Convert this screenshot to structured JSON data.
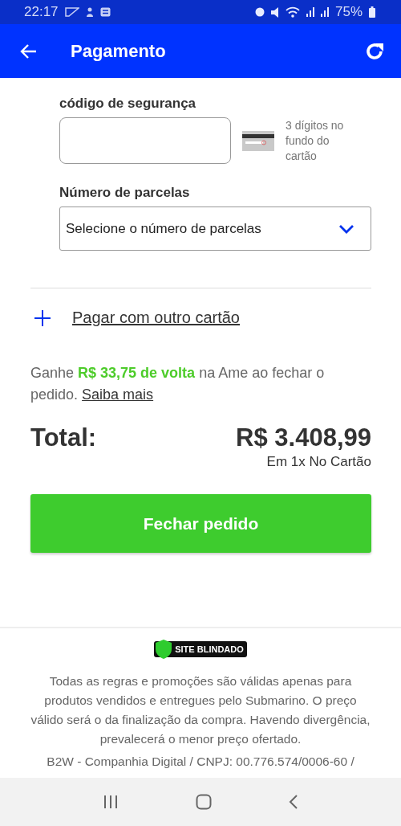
{
  "status_bar": {
    "time": "22:17",
    "battery": "75%"
  },
  "app_bar": {
    "title": "Pagamento"
  },
  "security_code": {
    "label": "código de segurança",
    "hint": "3 dígitos no fundo do cartão"
  },
  "installments": {
    "label": "Número de parcelas",
    "placeholder": "Selecione o número de parcelas"
  },
  "other_card": {
    "label": "Pagar com outro cartão"
  },
  "cashback": {
    "text": "Ganhe **R$ 33,75 de volta** na Ame ao fechar o pedido.",
    "link": "Saiba mais"
  },
  "total": {
    "label": "Total:",
    "amount": "R$ 3.408,99",
    "terms": "Em 1x No Cartão"
  },
  "submit": {
    "label": "Fechar pedido"
  },
  "footer": {
    "badge": "SITE BLINDADO",
    "disclaimer": "Todas as regras e promoções são válidas apenas para produtos vendidos e entregues pelo Submarino. O preço válido será o da finalização da compra. Havendo divergência, prevalecerá o menor preço ofertado.",
    "company": "B2W - Companhia Digital / CNPJ: 00.776.574/0006-60 /"
  }
}
